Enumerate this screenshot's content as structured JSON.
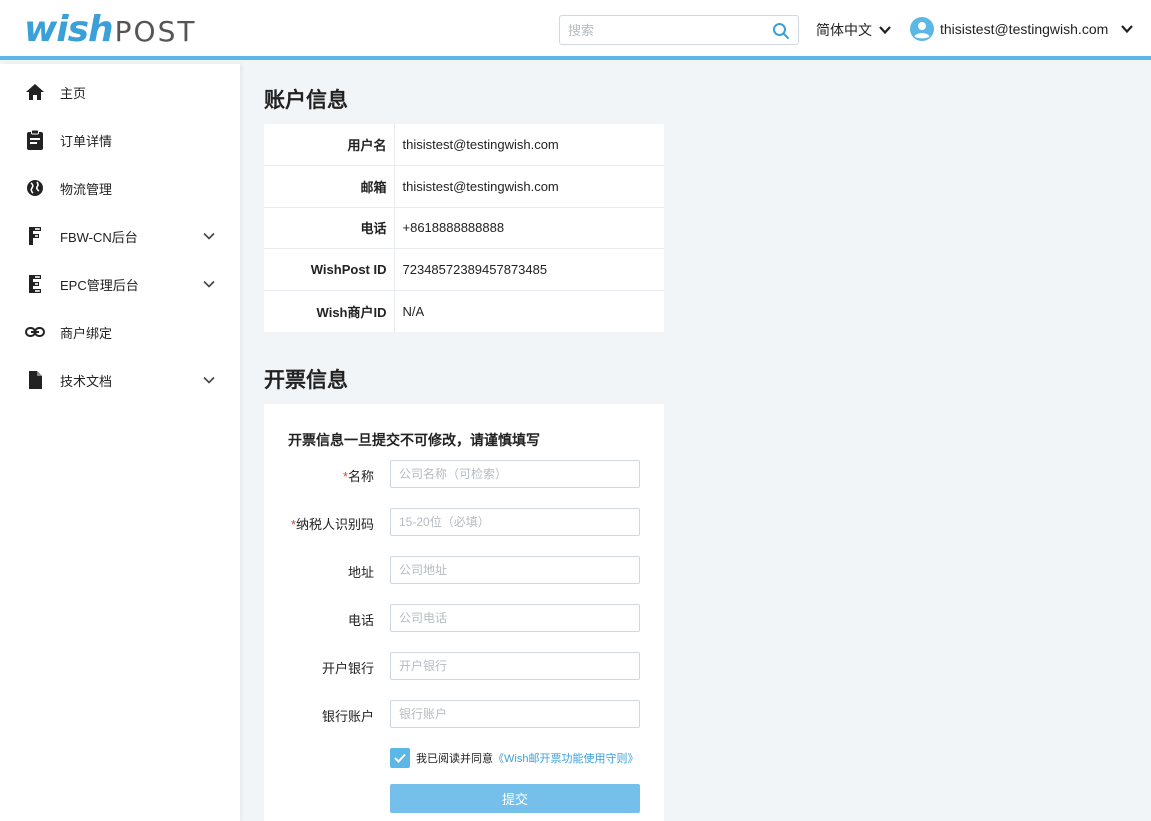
{
  "header": {
    "logo": {
      "wish": "wish",
      "post": "POST"
    },
    "search": {
      "placeholder": "搜索",
      "icon": "search-icon"
    },
    "language": "简体中文",
    "user_email": "thisistest@testingwish.com"
  },
  "sidebar": {
    "items": [
      {
        "label": "主页",
        "icon": "home-icon",
        "expandable": false
      },
      {
        "label": "订单详情",
        "icon": "clipboard-icon",
        "expandable": false
      },
      {
        "label": "物流管理",
        "icon": "globe-icon",
        "expandable": false
      },
      {
        "label": "FBW-CN后台",
        "icon": "fbw-icon",
        "expandable": true
      },
      {
        "label": "EPC管理后台",
        "icon": "epc-icon",
        "expandable": true
      },
      {
        "label": "商户绑定",
        "icon": "link-icon",
        "expandable": false
      },
      {
        "label": "技术文档",
        "icon": "document-icon",
        "expandable": true
      }
    ]
  },
  "account": {
    "title": "账户信息",
    "rows": [
      {
        "key": "用户名",
        "value": "thisistest@testingwish.com"
      },
      {
        "key": "邮箱",
        "value": "thisistest@testingwish.com"
      },
      {
        "key": "电话",
        "value": "+8618888888888"
      },
      {
        "key": "WishPost ID",
        "value": "72348572389457873485"
      },
      {
        "key": "Wish商户ID",
        "value": "N/A"
      }
    ]
  },
  "invoice": {
    "title": "开票信息",
    "note": "开票信息一旦提交不可修改，请谨慎填写",
    "fields": [
      {
        "label": "名称",
        "required": true,
        "placeholder": "公司名称（可检索）"
      },
      {
        "label": "纳税人识别码",
        "required": true,
        "placeholder": "15-20位（必填）"
      },
      {
        "label": "地址",
        "required": false,
        "placeholder": "公司地址"
      },
      {
        "label": "电话",
        "required": false,
        "placeholder": "公司电话"
      },
      {
        "label": "开户银行",
        "required": false,
        "placeholder": "开户银行"
      },
      {
        "label": "银行账户",
        "required": false,
        "placeholder": "银行账户"
      }
    ],
    "required_mark": "*",
    "agree_text": "我已阅读并同意",
    "agree_link": "《Wish邮开票功能使用守则》",
    "agree_checked": true,
    "submit_label": "提交"
  },
  "colors": {
    "accent": "#5bb7e5",
    "logo_blue": "#3ba0d8",
    "required": "#e0443b",
    "submit": "#74c0ea"
  }
}
